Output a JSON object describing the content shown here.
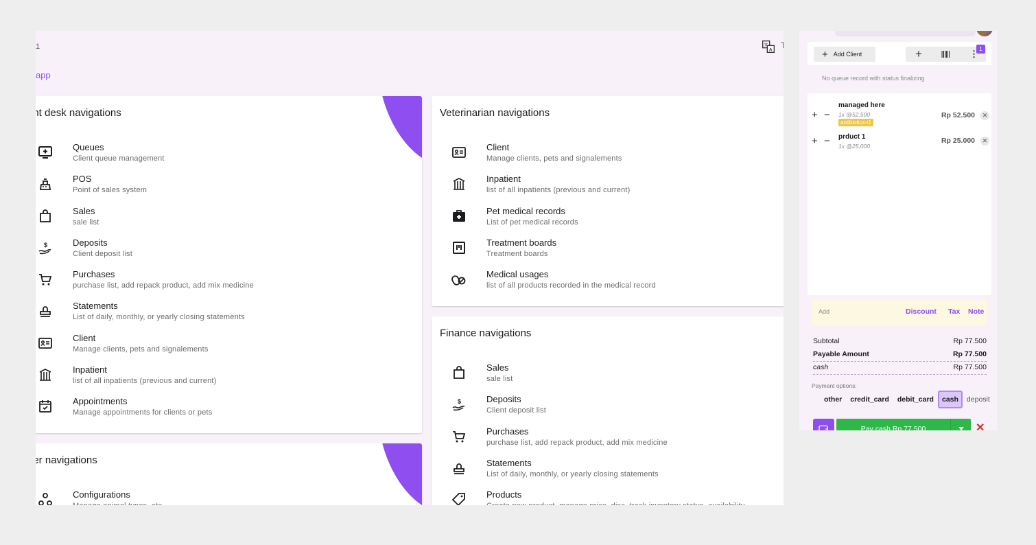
{
  "app": {
    "top_number": "1",
    "subtitle": "app",
    "edge_char": "T",
    "icons": {
      "translate": "translate-icon"
    }
  },
  "front_desk": {
    "title": "ont desk navigations",
    "items": [
      {
        "title": "Queues",
        "desc": "Client queue management",
        "icon": "monitor-plus-icon"
      },
      {
        "title": "POS",
        "desc": "Point of sales system",
        "icon": "cash-register-icon"
      },
      {
        "title": "Sales",
        "desc": "sale list",
        "icon": "shopping-bag-icon"
      },
      {
        "title": "Deposits",
        "desc": "Client deposit list",
        "icon": "hand-money-icon"
      },
      {
        "title": "Purchases",
        "desc": "purchase list, add repack product, add mix medicine",
        "icon": "cart-icon"
      },
      {
        "title": "Statements",
        "desc": "List of daily, monthly, or yearly closing statements",
        "icon": "stamp-icon"
      },
      {
        "title": "Client",
        "desc": "Manage clients, pets and signalements",
        "icon": "id-card-icon"
      },
      {
        "title": "Inpatient",
        "desc": "list of all inpatients (previous and current)",
        "icon": "pet-cage-icon"
      },
      {
        "title": "Appointments",
        "desc": "Manage appointments for clients or pets",
        "icon": "calendar-check-icon"
      }
    ]
  },
  "veterinarian": {
    "title": "Veterinarian navigations",
    "items": [
      {
        "title": "Client",
        "desc": "Manage clients, pets and signalements",
        "icon": "id-card-icon"
      },
      {
        "title": "Inpatient",
        "desc": "list of all inpatients (previous and current)",
        "icon": "pet-cage-icon"
      },
      {
        "title": "Pet medical records",
        "desc": "List of pet medical records",
        "icon": "medical-bag-icon"
      },
      {
        "title": "Treatment boards",
        "desc": "Treatment boards",
        "icon": "board-icon"
      },
      {
        "title": "Medical usages",
        "desc": "list of all products recorded in the medical record",
        "icon": "pills-icon"
      }
    ]
  },
  "finance": {
    "title": "Finance navigations",
    "items": [
      {
        "title": "Sales",
        "desc": "sale list",
        "icon": "shopping-bag-icon"
      },
      {
        "title": "Deposits",
        "desc": "Client deposit list",
        "icon": "hand-money-icon"
      },
      {
        "title": "Purchases",
        "desc": "purchase list, add repack product, add mix medicine",
        "icon": "cart-icon"
      },
      {
        "title": "Statements",
        "desc": "List of daily, monthly, or yearly closing statements",
        "icon": "stamp-icon"
      },
      {
        "title": "Products",
        "desc": "Create new product, manage price, disc, track inventory status, availability",
        "icon": "tag-icon"
      }
    ]
  },
  "other": {
    "title": "her navigations",
    "items": [
      {
        "title": "Configurations",
        "desc": "Manage animal types, etc",
        "icon": "hub-icon"
      }
    ]
  },
  "pos": {
    "add_client_label": "Add Client",
    "badge_count": "1",
    "queue_empty": "No queue record with status finalizing",
    "cart": [
      {
        "name": "managed here",
        "qty": "1x @52,500",
        "tag": "antibiotics-t1",
        "price": "Rp 52.500"
      },
      {
        "name": "prduct 1",
        "qty": "1x @25,000",
        "tag": "",
        "price": "Rp 25.000"
      }
    ],
    "adjust": {
      "add": "Add",
      "discount": "Discount",
      "tax": "Tax",
      "note": "Note"
    },
    "totals": {
      "subtotal_label": "Subtotal",
      "subtotal": "Rp 77.500",
      "payable_label": "Payable Amount",
      "payable": "Rp 77.500",
      "cash_label": "cash",
      "cash": "Rp 77.500"
    },
    "payment_options_label": "Payment options:",
    "payment_options": [
      "other",
      "credit_card",
      "debit_card",
      "cash",
      "deposit"
    ],
    "selected_payment": "cash",
    "pay_button": "Pay cash Rp 77.500",
    "colors": {
      "accent": "#8e4ef0",
      "pay": "#2fb84a",
      "cancel": "#d32f2f",
      "tag": "#f3c344"
    }
  }
}
